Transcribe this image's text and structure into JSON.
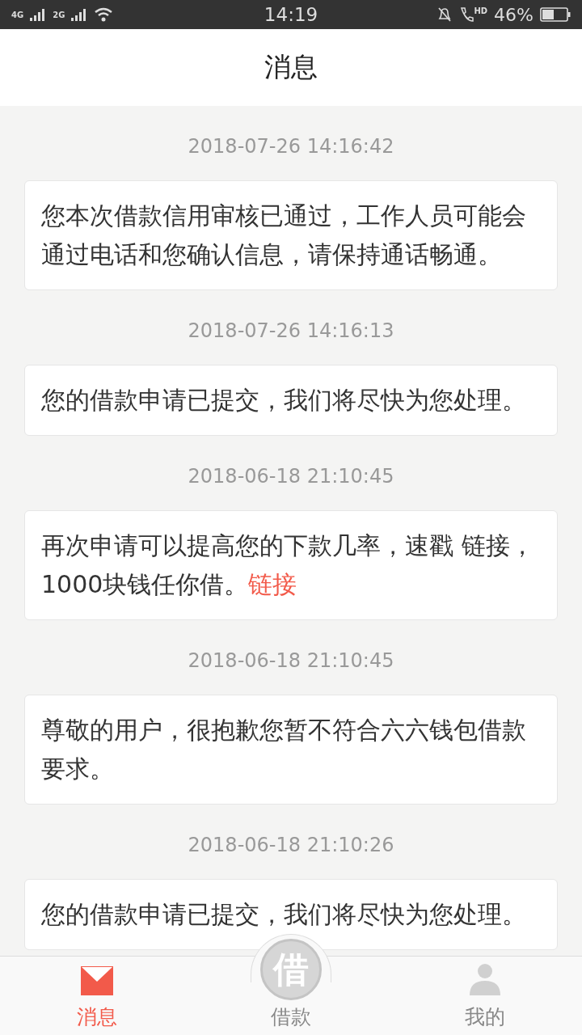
{
  "status_bar": {
    "network_1": "4G",
    "network_2": "2G",
    "time": "14:19",
    "call_badge": "HD",
    "battery": "46%"
  },
  "header": {
    "title": "消息"
  },
  "messages": [
    {
      "time": "2018-07-26 14:16:42",
      "text": "您本次借款信用审核已通过，工作人员可能会通过电话和您确认信息，请保持通话畅通。"
    },
    {
      "time": "2018-07-26 14:16:13",
      "text": "您的借款申请已提交，我们将尽快为您处理。"
    },
    {
      "time": "2018-06-18 21:10:45",
      "text": "再次申请可以提高您的下款几率，速戳 链接，1000块钱任你借。",
      "link": "链接"
    },
    {
      "time": "2018-06-18 21:10:45",
      "text": "尊敬的用户，很抱歉您暂不符合六六钱包借款要求。"
    },
    {
      "time": "2018-06-18 21:10:26",
      "text": "您的借款申请已提交，我们将尽快为您处理。"
    }
  ],
  "tab_bar": {
    "center_badge": "借",
    "tabs": [
      {
        "kind": "messages",
        "label": "消息",
        "selected": true
      },
      {
        "kind": "loan",
        "label": "借款",
        "selected": false
      },
      {
        "kind": "profile",
        "label": "我的",
        "selected": false
      }
    ]
  }
}
